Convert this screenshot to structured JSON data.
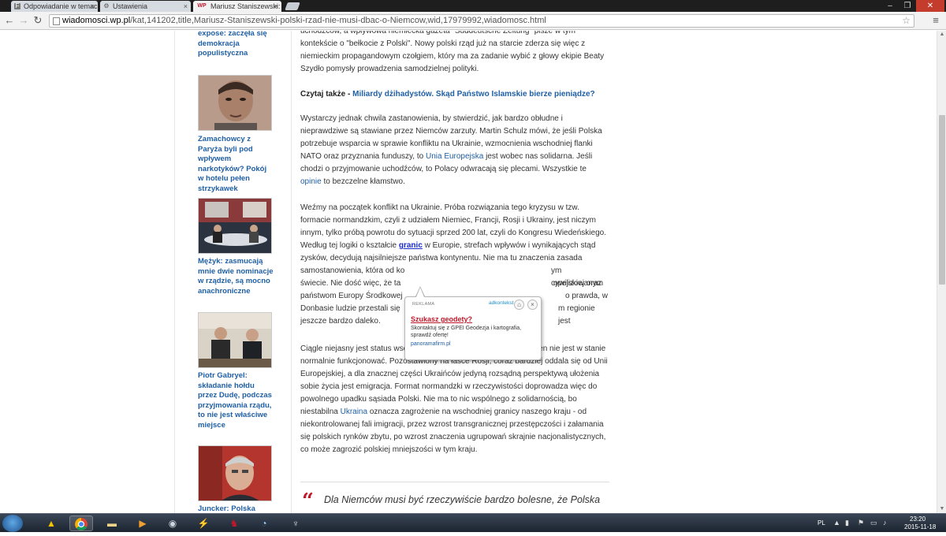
{
  "tabs": [
    {
      "label": "Odpowiadanie w temacie",
      "favicon": "F"
    },
    {
      "label": "Ustawienia",
      "favicon": "⚙"
    },
    {
      "label": "Mariusz Staniszewski: pols",
      "favicon": "WP"
    }
  ],
  "address": {
    "host": "wiadomosci.wp.pl",
    "path": "/kat,141202,title,Mariusz-Staniszewski-polski-rzad-nie-musi-dbac-o-Niemcow,wid,17979992,wiadomosc.html"
  },
  "sidebar": {
    "items": [
      {
        "title": "expose: zaczęła się demokracja populistyczna"
      },
      {
        "title": "Zamachowcy z Paryża byli pod wpływem narkotyków? Pokój w hotelu pełen strzykawek"
      },
      {
        "title": "Mężyk: zasmucają mnie dwie nominacje w rządzie, są mocno anachroniczne"
      },
      {
        "title": "Piotr Gabryel: składanie hołdu przez Dudę, podczas przyjmowania rządu, to nie jest właściwe miejsce"
      },
      {
        "title": "Juncker: Polska będzie"
      }
    ]
  },
  "article": {
    "p1": {
      "l1": "uchodźców, a wpływowa niemiecka gazeta \"Süddeutsche Zeitung\" pisze w tym",
      "l2": "kontekście o \"bełkocie z Polski\". Nowy polski rząd już na starcie zderza się więc z",
      "l3": "niemieckim propagandowym czołgiem, który ma za zadanie wybić z głowy ekipie Beaty",
      "l4": "Szydło pomysły prowadzenia samodzielnej polityki."
    },
    "read_also": {
      "prefix": "Czytaj także - ",
      "link": "Miliardy dżihadystów. Skąd Państwo Islamskie bierze pieniądze?"
    },
    "p2": {
      "l1": "Wystarczy jednak chwila zastanowienia, by stwierdzić, jak bardzo obłudne i",
      "l2": "nieprawdziwe są stawiane przez Niemców zarzuty. Martin Schulz mówi, że jeśli Polska",
      "l3": "potrzebuje wsparcia w sprawie konfliktu na Ukrainie, wzmocnienia wschodniej flanki",
      "l4a": "NATO oraz przyznania funduszy, to ",
      "l4_link": "Unia Europejska",
      "l4b": " jest wobec nas solidarna. Jeśli",
      "l5": "chodzi o przyjmowanie uchodźców, to Polacy odwracają się plecami. Wszystkie te",
      "l6_link": "opinie",
      "l6b": " to bezczelne kłamstwo."
    },
    "p3": {
      "l1": "Weźmy na początek konflikt na Ukrainie. Próba rozwiązania tego kryzysu w tzw.",
      "l2": "formacie normandzkim, czyli z udziałem Niemiec, Francji, Rosji i Ukrainy, jest niczym",
      "l3": "innym, tylko próbą powrotu do sytuacji sprzed 200 lat, czyli do Kongresu Wiedeńskiego.",
      "l4a": "Według tej logiki o kształcie ",
      "l4_kw": "granic",
      "l4b": " w Europie, strefach wpływów i wynikających stąd",
      "l5": "zysków, decydują najsilniejsze państwa kontynentu. Nie ma tu znaczenia zasada",
      "l6": "samostanowienia, która od ko",
      "l6r": "ym cywilizowanym",
      "l7": "świecie. Nie dość więc, że ta",
      "l7r": "opejskiej oraz",
      "l8": "państwom Europy Środkowej",
      "l8r": "o prawda, w",
      "l9": "Donbasie ludzie przestali się",
      "l9r": "m regionie jest",
      "l10": "jeszcze bardzo daleko."
    },
    "p4": {
      "l1": "Ciągle niejasny jest status wschodniej części Ukrainy, przez co kraj ten nie jest w stanie",
      "l2": "normalnie funkcjonować. Pozostawiony na łasce Rosji, coraz bardziej oddala się od Unii",
      "l3": "Europejskiej, a dla znacznej części Ukraińców jedyną rozsądną perspektywą ułożenia",
      "l4": "sobie życia jest emigracja. Format normandzki w rzeczywistości doprowadza więc do",
      "l5": "powolnego upadku sąsiada Polski. Nie ma to nic wspólnego z solidarnością, bo",
      "l6a": "niestabilna ",
      "l6_link": "Ukraina",
      "l6b": " oznacza zagrożenie na wschodniej granicy naszego kraju - od",
      "l7": "niekontrolowanej fali imigracji, przez wzrost transgranicznej przestępczości i załamania",
      "l8": "się polskich rynków zbytu, po wzrost znaczenia ugrupowań skrajnie nacjonalistycznych,",
      "l9": "co może zagrozić polskiej mniejszości w tym kraju."
    },
    "quote_mark": "“",
    "quote": "Dla Niemców musi być rzeczywiście bardzo bolesne, że Polska"
  },
  "ad": {
    "label": "REKLAMA",
    "brand": "adkontekst",
    "headline": "Szukasz geodety?",
    "body": "Skontaktuj się z GPEI Geodezja i kartografia, sprawdź ofertę!",
    "link": "panoramafirm.pl"
  },
  "taskbar": {
    "lang": "PL",
    "time": "23:20",
    "date": "2015-11-18"
  },
  "colors": {
    "link": "#1f5fa5",
    "keyword": "#1a2bd0",
    "accent_red": "#c0182a"
  }
}
